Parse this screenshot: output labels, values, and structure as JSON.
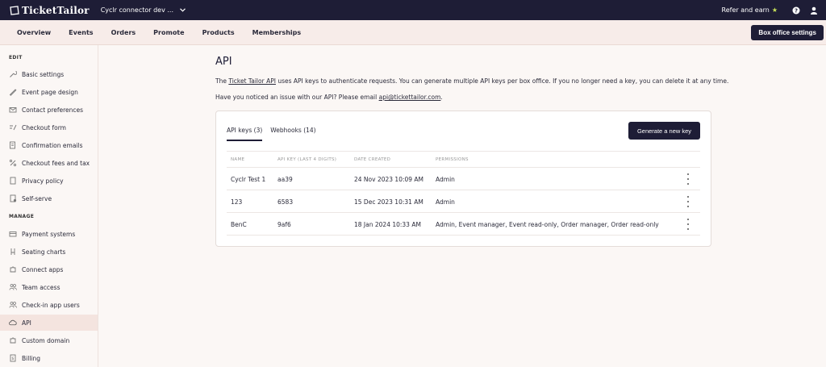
{
  "topbar": {
    "logo_text": "TicketTailor",
    "org_name": "Cyclr connector dev ...",
    "refer_label": "Refer and earn",
    "refer_star": "★",
    "help_icon": "help-circle-icon",
    "user_icon": "user-icon"
  },
  "nav": {
    "items": [
      "Overview",
      "Events",
      "Orders",
      "Promote",
      "Products",
      "Memberships"
    ],
    "box_office_label": "Box office settings"
  },
  "sidebar": {
    "edit_heading": "EDIT",
    "edit_items": [
      {
        "label": "Basic settings",
        "icon": "wrench-icon"
      },
      {
        "label": "Event page design",
        "icon": "brush-icon"
      },
      {
        "label": "Contact preferences",
        "icon": "mail-icon"
      },
      {
        "label": "Checkout form",
        "icon": "form-icon"
      },
      {
        "label": "Confirmation emails",
        "icon": "email-doc-icon"
      },
      {
        "label": "Checkout fees and tax",
        "icon": "percent-icon"
      },
      {
        "label": "Privacy policy",
        "icon": "document-icon"
      },
      {
        "label": "Self-serve",
        "icon": "self-serve-icon"
      }
    ],
    "manage_heading": "MANAGE",
    "manage_items": [
      {
        "label": "Payment systems",
        "icon": "card-icon"
      },
      {
        "label": "Seating charts",
        "icon": "chair-icon"
      },
      {
        "label": "Connect apps",
        "icon": "puzzle-icon"
      },
      {
        "label": "Team access",
        "icon": "team-icon"
      },
      {
        "label": "Check-in app users",
        "icon": "users-icon"
      },
      {
        "label": "API",
        "icon": "cloud-icon",
        "active": true
      },
      {
        "label": "Custom domain",
        "icon": "domain-icon"
      },
      {
        "label": "Billing",
        "icon": "billing-icon"
      }
    ]
  },
  "main": {
    "title": "API",
    "intro_prefix": "The ",
    "intro_link": "Ticket Tailor API",
    "intro_suffix": " uses API keys to authenticate requests. You can generate multiple API keys per box office. If you no longer need a key, you can delete it at any time.",
    "issue_prefix": "Have you noticed an issue with our API? Please email ",
    "issue_email": "api@tickettailor.com",
    "issue_suffix": ".",
    "tabs": [
      {
        "label": "API keys (3)",
        "active": true
      },
      {
        "label": "Webhooks (14)",
        "active": false
      }
    ],
    "generate_label": "Generate a new key",
    "columns": [
      "NAME",
      "API KEY (LAST 4 DIGITS)",
      "DATE CREATED",
      "PERMISSIONS"
    ],
    "rows": [
      {
        "name": "Cyclr Test 1",
        "key": "aa39",
        "date": "24 Nov 2023 10:09 AM",
        "permissions": "Admin"
      },
      {
        "name": "123",
        "key": "6583",
        "date": "15 Dec 2023 10:31 AM",
        "permissions": "Admin"
      },
      {
        "name": "BenC",
        "key": "9af6",
        "date": "18 Jan 2024 10:33 AM",
        "permissions": "Admin, Event manager, Event read-only, Order manager, Order read-only"
      }
    ]
  }
}
